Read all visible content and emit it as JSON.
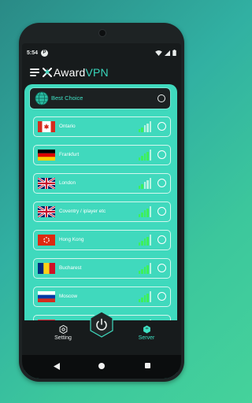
{
  "status_bar": {
    "time": "5:54",
    "notification_badge": "P"
  },
  "header": {
    "brand_prefix": "Award",
    "brand_suffix": "VPN"
  },
  "best_choice": {
    "label": "Best Choice",
    "selected": false
  },
  "servers": [
    {
      "label": "Ontario",
      "flag": "canada",
      "signal_level": 2,
      "selected": false
    },
    {
      "label": "Frankfurt",
      "flag": "germany",
      "signal_level": 4,
      "selected": false
    },
    {
      "label": "London",
      "flag": "uk",
      "signal_level": 2,
      "selected": false
    },
    {
      "label": "Coventry / iplayer etc",
      "flag": "uk",
      "signal_level": 4,
      "selected": false
    },
    {
      "label": "Hong Kong",
      "flag": "hong-kong",
      "signal_level": 4,
      "selected": false
    },
    {
      "label": "Bucharest",
      "flag": "romania",
      "signal_level": 4,
      "selected": false
    },
    {
      "label": "Moscow",
      "flag": "russia",
      "signal_level": 4,
      "selected": false
    },
    {
      "label": "",
      "flag": "singapore",
      "signal_level": 4,
      "selected": false
    }
  ],
  "bottom_nav": {
    "setting_label": "Setting",
    "server_label": "Server",
    "active": "Server"
  },
  "colors": {
    "accent": "#3fd9bd",
    "dark": "#171b1c",
    "signal_on": "#3df05a",
    "signal_off": "#b9f3e2"
  }
}
